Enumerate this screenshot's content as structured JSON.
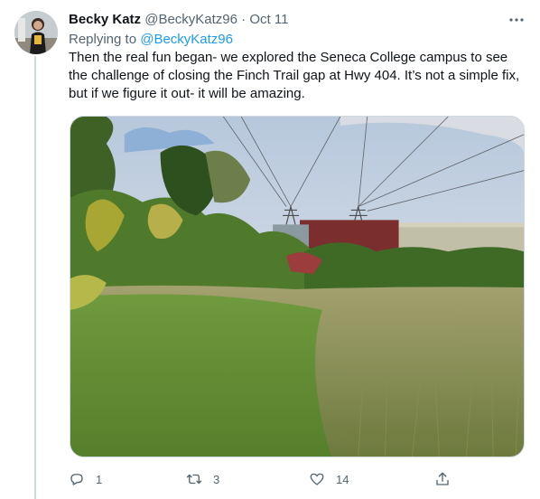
{
  "tweet": {
    "display_name": "Becky Katz",
    "handle": "@BeckyKatz96",
    "separator": "·",
    "date": "Oct 11",
    "replying_prefix": "Replying to",
    "replying_to": "@BeckyKatz96",
    "text": "Then the real fun began- we explored the Seneca College campus to see the challenge of closing the Finch Trail gap at Hwy 404. It’s not a simple fix, but if we figure it out- it will be amazing.",
    "media_alt": "Photo of a grassy field with shrubs, hydro towers and a highway sound wall",
    "icons": {
      "more": "more-horizontal-icon",
      "reply": "reply-icon",
      "retweet": "retweet-icon",
      "like": "heart-icon",
      "share": "share-icon"
    }
  },
  "actions": {
    "reply_count": "1",
    "retweet_count": "3",
    "like_count": "14"
  },
  "colors": {
    "link": "#1d9bf0",
    "secondary_text": "#536471",
    "thread_line": "#cfd9de"
  }
}
